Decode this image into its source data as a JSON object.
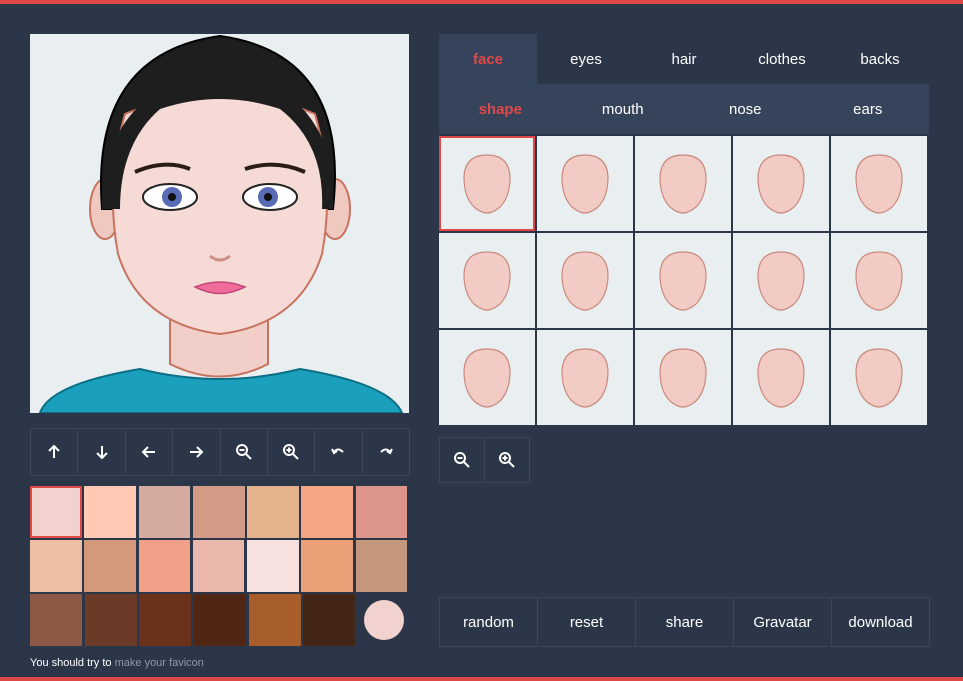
{
  "main_tabs": [
    {
      "label": "face",
      "active": true
    },
    {
      "label": "eyes",
      "active": false
    },
    {
      "label": "hair",
      "active": false
    },
    {
      "label": "clothes",
      "active": false
    },
    {
      "label": "backs",
      "active": false
    }
  ],
  "sub_tabs": [
    {
      "label": "shape",
      "active": true
    },
    {
      "label": "mouth",
      "active": false
    },
    {
      "label": "nose",
      "active": false
    },
    {
      "label": "ears",
      "active": false
    }
  ],
  "move_toolbar": [
    "arrow-up-icon",
    "arrow-down-icon",
    "arrow-left-icon",
    "arrow-right-icon",
    "zoom-out-icon",
    "zoom-in-icon",
    "undo-icon",
    "redo-icon"
  ],
  "zoom_toolbar": [
    "zoom-out-icon",
    "zoom-in-icon"
  ],
  "skin_colors": [
    [
      "#f2d2cf",
      "#ffc9b3",
      "#d4a9a0",
      "#d39a86",
      "#e5b28e",
      "#f4a584",
      "#dc948b"
    ],
    [
      "#ecbea4",
      "#d4987a",
      "#f0a086",
      "#eab7ac",
      "#f6e1df",
      "#eca078",
      "#c5977d"
    ],
    [
      "#8c5a44",
      "#6b3b28",
      "#6a321a",
      "#522615",
      "#a75e2a",
      "#442617"
    ]
  ],
  "selected_color": "#f2d2cf",
  "face_shapes_count": 15,
  "selected_shape_index": 0,
  "actions": [
    "random",
    "reset",
    "share",
    "Gravatar",
    "download"
  ],
  "favicon": {
    "prefix": "You should try to",
    "link": "make your favicon"
  },
  "colors": {
    "accent": "#e04848",
    "background": "#2b3748",
    "panel": "#35445a",
    "tile": "#e9eef0"
  }
}
